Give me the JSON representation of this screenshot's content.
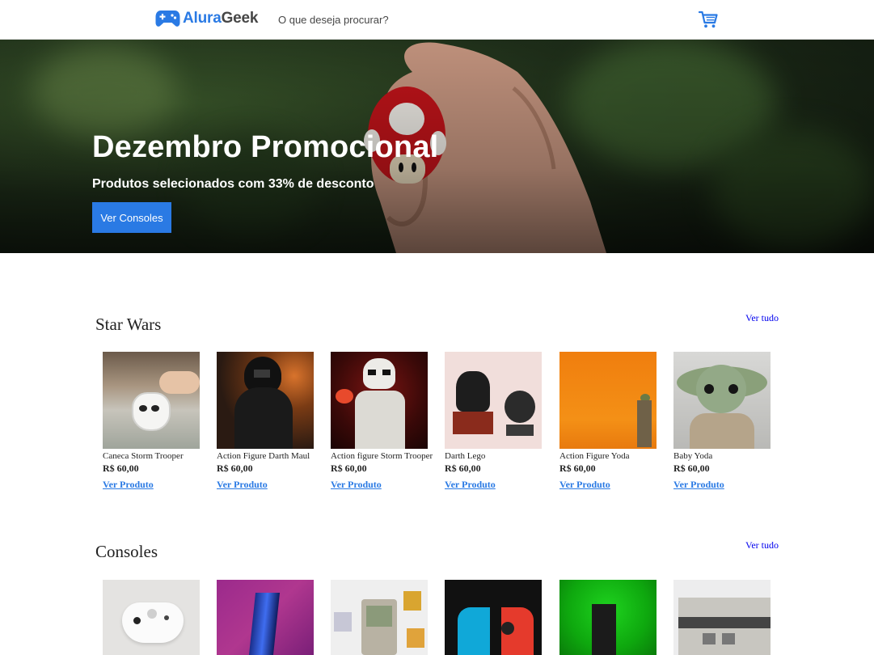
{
  "header": {
    "logo": {
      "part1": "Alura",
      "part2": "Geek"
    },
    "search_placeholder": "O que deseja procurar?"
  },
  "hero": {
    "title": "Dezembro Promocional",
    "subtitle": "Produtos selecionados com 33% de desconto",
    "button_label": "Ver Consoles"
  },
  "sections": [
    {
      "title": "Star Wars",
      "see_all": "Ver tudo",
      "products": [
        {
          "name": "Caneca Storm Trooper",
          "price": "R$ 60,00",
          "link": "Ver Produto"
        },
        {
          "name": "Action Figure Darth Maul",
          "price": "R$ 60,00",
          "link": "Ver Produto"
        },
        {
          "name": "Action figure Storm Trooper",
          "price": "R$ 60,00",
          "link": "Ver Produto"
        },
        {
          "name": "Darth Lego",
          "price": "R$ 60,00",
          "link": "Ver Produto"
        },
        {
          "name": "Action Figure Yoda",
          "price": "R$ 60,00",
          "link": "Ver Produto"
        },
        {
          "name": "Baby Yoda",
          "price": "R$ 60,00",
          "link": "Ver Produto"
        }
      ]
    },
    {
      "title": "Consoles",
      "see_all": "Ver tudo"
    }
  ],
  "colors": {
    "accent": "#2a7ae4",
    "logo_dark": "#464646"
  }
}
